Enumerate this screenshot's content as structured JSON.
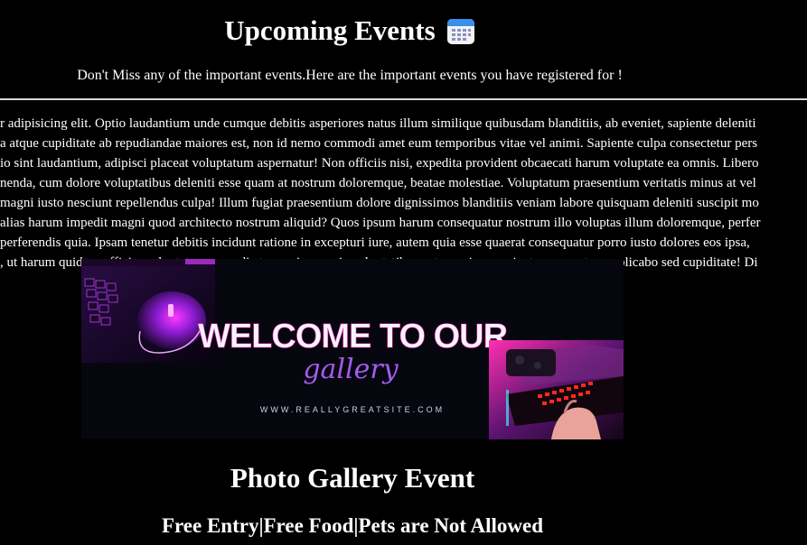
{
  "header": {
    "title": "Upcoming Events",
    "title_icon": "calendar-icon",
    "subtitle": "Don't Miss any of the important events.Here are the important events you have registered for !"
  },
  "intro": {
    "lines": [
      "r adipisicing elit. Optio laudantium unde cumque debitis asperiores natus illum similique quibusdam blanditiis, ab eveniet, sapiente deleniti",
      "a atque cupiditate ab repudiandae maiores est, non id nemo commodi amet eum temporibus vitae vel animi. Sapiente culpa consectetur pers",
      "io sint laudantium, adipisci placeat voluptatum aspernatur! Non officiis nisi, expedita provident obcaecati harum voluptate ea omnis. Libero",
      "nenda, cum dolore voluptatibus deleniti esse quam at nostrum doloremque, beatae molestiae. Voluptatum praesentium veritatis minus at vel",
      "magni iusto nesciunt repellendus culpa! Illum fugiat praesentium dolore dignissimos blanditiis veniam labore quisquam deleniti suscipit mo",
      "alias harum impedit magni quod architecto nostrum aliquid? Quos ipsum harum consequatur nostrum illo voluptas illum doloremque, perfer",
      "perferendis quia. Ipsam tenetur debitis incidunt ratione in excepturi iure, autem quia esse quaerat consequatur porro iusto dolores eos ipsa,",
      ", ut harum quidem officia, voluptate commodi et magni corporis voluptatibus autem minus sapiente aspernatur, explicabo sed cupiditate! Di"
    ]
  },
  "banner": {
    "heading": "WELCOME TO OUR",
    "script_word": "gallery",
    "url": "WWW.REALLYGREATSITE.COM",
    "accent_color": "#b44cff",
    "pink_color": "#ff2fb0"
  },
  "event": {
    "title": "Photo Gallery Event",
    "info": "Free Entry|Free Food|Pets are Not Allowed"
  }
}
